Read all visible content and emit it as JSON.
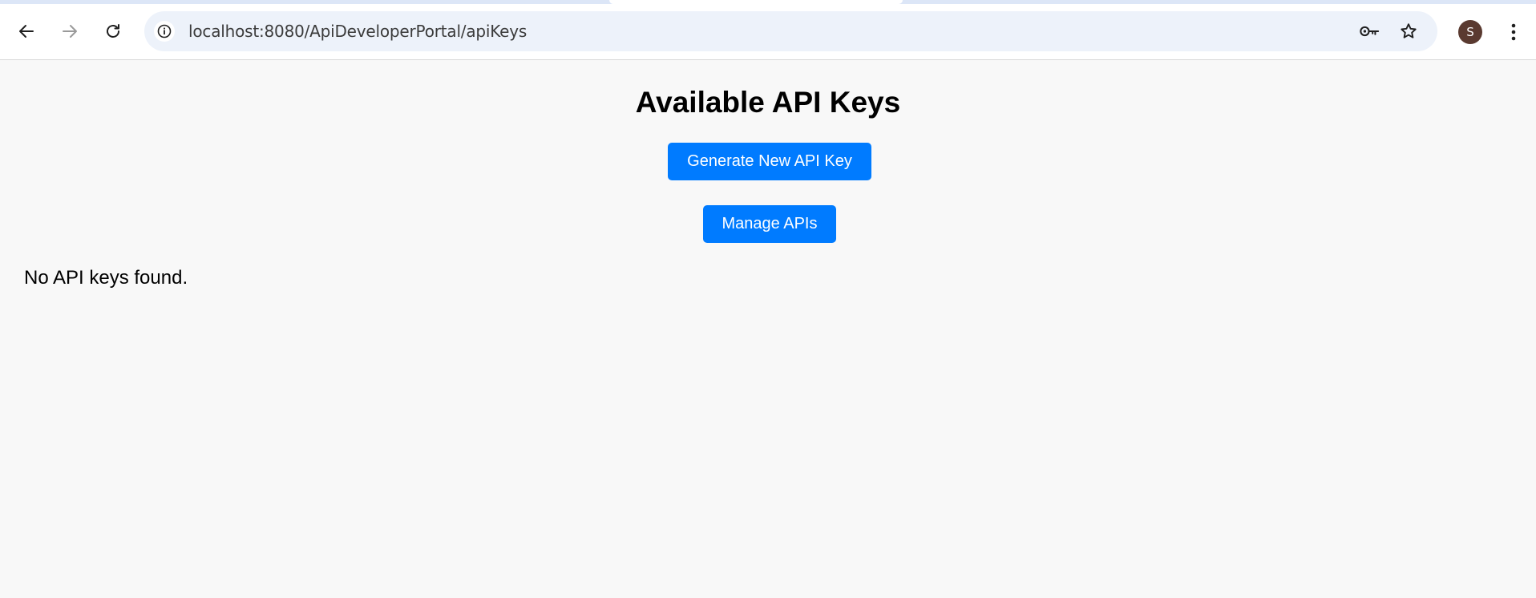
{
  "browser": {
    "url": "localhost:8080/ApiDeveloperPortal/apiKeys",
    "profile_initial": "S",
    "icons": {
      "back": "arrow-left-icon",
      "forward": "arrow-right-icon",
      "reload": "reload-icon",
      "site_info": "info-icon",
      "password": "key-icon",
      "bookmark": "star-icon",
      "menu": "kebab-menu-icon"
    },
    "colors": {
      "omnibox_bg": "#edf2fa",
      "avatar_bg": "#5a3a30"
    }
  },
  "page": {
    "title": "Available API Keys",
    "generate_button_label": "Generate New API Key",
    "manage_button_label": "Manage APIs",
    "empty_message": "No API keys found.",
    "colors": {
      "primary_button": "#007bff",
      "background": "#f8f8f8"
    }
  }
}
